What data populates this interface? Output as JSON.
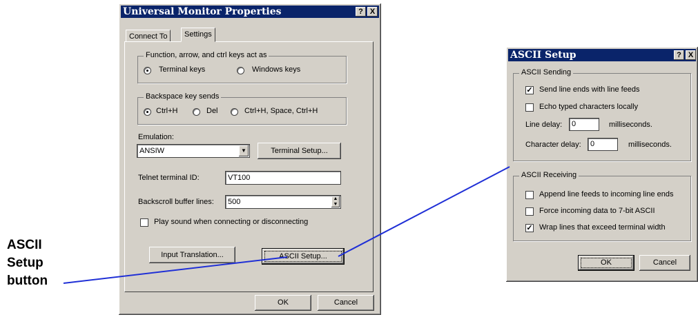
{
  "annotation": {
    "lines": [
      "ASCII",
      "Setup",
      "button"
    ],
    "line_color": "#1f2fd6"
  },
  "props_dialog": {
    "title": "Universal Monitor Properties",
    "tabs": [
      "Connect To",
      "Settings"
    ],
    "active_tab": "Settings",
    "fn_keys_group": "Function, arrow, and ctrl keys act as",
    "fn_keys_options": [
      "Terminal keys",
      "Windows keys"
    ],
    "fn_keys_selected": "Terminal keys",
    "backspace_group": "Backspace key sends",
    "backspace_options": [
      "Ctrl+H",
      "Del",
      "Ctrl+H, Space, Ctrl+H"
    ],
    "backspace_selected": "Ctrl+H",
    "emulation_label": "Emulation:",
    "emulation_value": "ANSIW",
    "terminal_setup_button": "Terminal Setup...",
    "telnet_id_label": "Telnet terminal ID:",
    "telnet_id_value": "VT100",
    "backscroll_label": "Backscroll buffer lines:",
    "backscroll_value": "500",
    "play_sound_label": "Play sound when connecting or disconnecting",
    "play_sound_checked": false,
    "input_translation_button": "Input Translation...",
    "ascii_setup_button": "ASCII Setup...",
    "ok_button": "OK",
    "cancel_button": "Cancel",
    "help_glyph": "?",
    "close_glyph": "X"
  },
  "ascii_dialog": {
    "title": "ASCII Setup",
    "sending_group": "ASCII Sending",
    "send_line_ends_label": "Send line ends with line feeds",
    "send_line_ends_checked": true,
    "echo_label": "Echo typed characters locally",
    "echo_checked": false,
    "line_delay_label": "Line delay:",
    "line_delay_value": "0",
    "line_delay_unit": "milliseconds.",
    "char_delay_label": "Character delay:",
    "char_delay_value": "0",
    "char_delay_unit": "milliseconds.",
    "receiving_group": "ASCII Receiving",
    "append_label": "Append line feeds to incoming line ends",
    "append_checked": false,
    "force_label": "Force incoming data to 7-bit ASCII",
    "force_checked": false,
    "wrap_label": "Wrap lines that exceed terminal width",
    "wrap_checked": true,
    "ok_button": "OK",
    "cancel_button": "Cancel",
    "help_glyph": "?",
    "close_glyph": "X",
    "check_glyph": "✓"
  }
}
